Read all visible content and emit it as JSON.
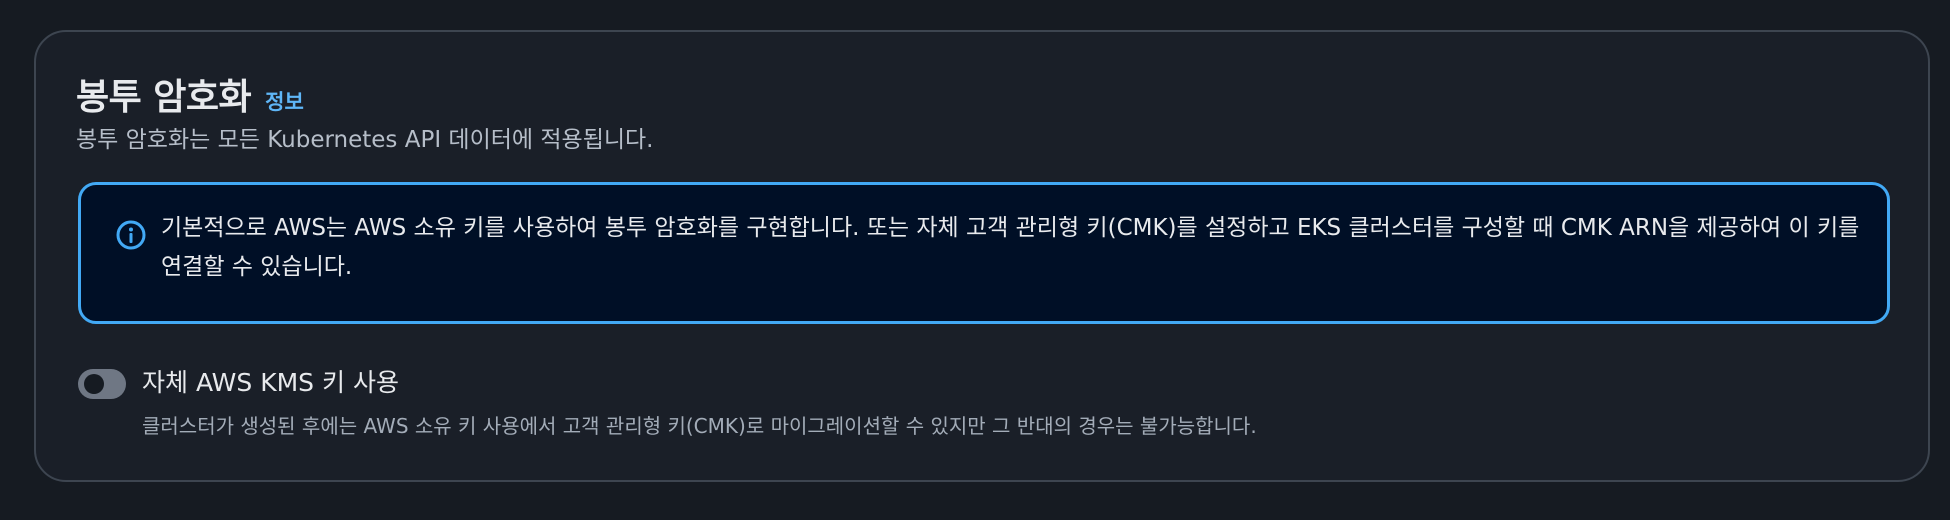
{
  "section": {
    "title": "봉투 암호화",
    "info_link": "정보",
    "description": "봉투 암호화는 모든 Kubernetes API 데이터에 적용됩니다."
  },
  "alert": {
    "icon": "info-icon",
    "text": "기본적으로 AWS는 AWS 소유 키를 사용하여 봉투 암호화를 구현합니다. 또는 자체 고객 관리형 키(CMK)를 설정하고 EKS 클러스터를 구성할 때 CMK ARN을 제공하여 이 키를 연결할 수 있습니다."
  },
  "toggle": {
    "label": "자체 AWS KMS 키 사용",
    "description": "클러스터가 생성된 후에는 AWS 소유 키 사용에서 고객 관리형 키(CMK)로 마이그레이션할 수 있지만 그 반대의 경우는 불가능합니다.",
    "checked": false
  },
  "colors": {
    "background": "#161b22",
    "panel": "#1a1f28",
    "accent": "#42a9f5",
    "link": "#5fb6f7",
    "alert_bg": "#000f26"
  }
}
